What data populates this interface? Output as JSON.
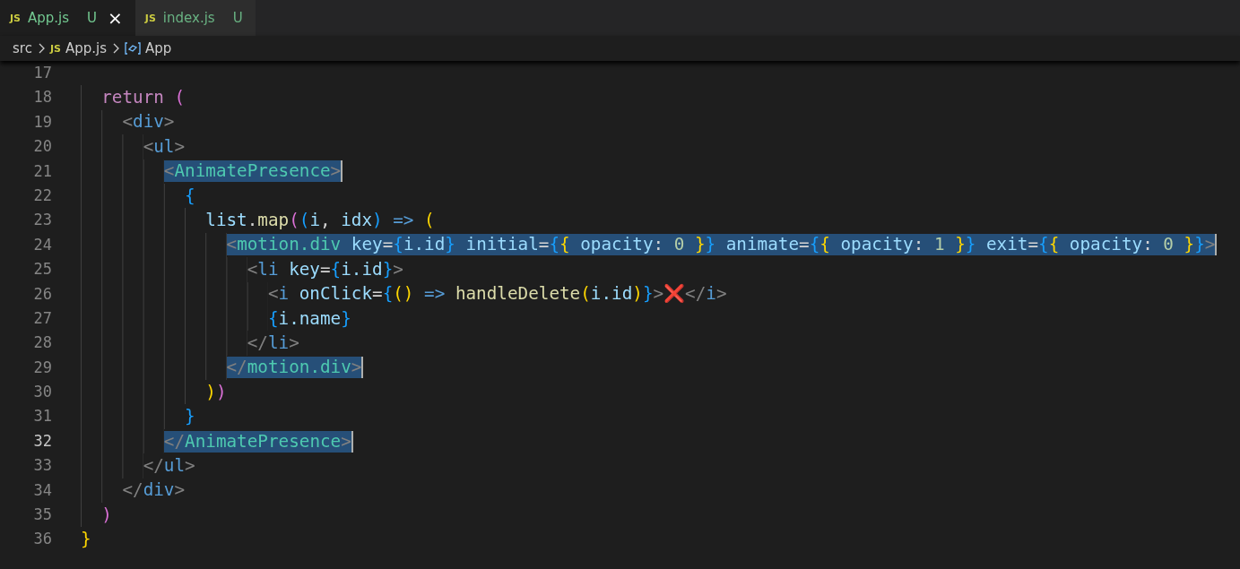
{
  "tabs": [
    {
      "icon_text": "JS",
      "label": "App.js",
      "status": "U",
      "selected": true,
      "close": "×"
    },
    {
      "icon_text": "JS",
      "label": "index.js",
      "status": "U",
      "selected": false
    }
  ],
  "breadcrumb": [
    {
      "kind": "folder",
      "label": "src"
    },
    {
      "kind": "file",
      "icon_text": "JS",
      "label": "App.js"
    },
    {
      "kind": "symbol",
      "label": "App"
    }
  ],
  "editor": {
    "lines": [
      {
        "number": "17",
        "current": false,
        "selected": false
      },
      {
        "number": "18",
        "current": false,
        "selected": false,
        "tokens": [
          {
            "kind": "keyword",
            "text": "  return"
          },
          {
            "kind": "bracket-pink",
            "text": " ("
          }
        ]
      },
      {
        "number": "19",
        "current": false,
        "selected": false,
        "tokens": [
          {
            "kind": "angle",
            "text": "    <"
          },
          {
            "kind": "tag",
            "text": "div"
          },
          {
            "kind": "angle",
            "text": ">"
          }
        ]
      },
      {
        "number": "20",
        "current": false,
        "selected": false,
        "tokens": [
          {
            "kind": "angle",
            "text": "      <"
          },
          {
            "kind": "tag",
            "text": "ul"
          },
          {
            "kind": "angle",
            "text": ">"
          }
        ]
      },
      {
        "number": "21",
        "current": false,
        "selected": true,
        "tokens": [
          {
            "kind": "angle",
            "text": "        <"
          },
          {
            "kind": "component",
            "text": "AnimatePresence"
          },
          {
            "kind": "angle",
            "text": ">"
          }
        ]
      },
      {
        "number": "22",
        "current": false,
        "selected": false,
        "tokens": [
          {
            "kind": "bracket-blue",
            "text": "          {"
          }
        ]
      },
      {
        "number": "23",
        "current": false,
        "selected": false,
        "tokens": [
          {
            "kind": "variable",
            "text": "            list"
          },
          {
            "kind": "plain",
            "text": "."
          },
          {
            "kind": "function",
            "text": "map"
          },
          {
            "kind": "bracket-pink",
            "text": "("
          },
          {
            "kind": "bracket-blue",
            "text": "("
          },
          {
            "kind": "variable",
            "text": "i"
          },
          {
            "kind": "plain",
            "text": ","
          },
          {
            "kind": "variable",
            "text": " idx"
          },
          {
            "kind": "bracket-blue",
            "text": ")"
          },
          {
            "kind": "operator",
            "text": " =>"
          },
          {
            "kind": "bracket-gold",
            "text": " ("
          }
        ]
      },
      {
        "number": "24",
        "current": false,
        "selected": true,
        "tokens": [
          {
            "kind": "angle",
            "text": "              <"
          },
          {
            "kind": "component",
            "text": "motion.div"
          },
          {
            "kind": "attribute",
            "text": " key"
          },
          {
            "kind": "plain",
            "text": "="
          },
          {
            "kind": "bracket-blue",
            "text": "{"
          },
          {
            "kind": "variable",
            "text": "i.id"
          },
          {
            "kind": "bracket-blue",
            "text": "}"
          },
          {
            "kind": "attribute",
            "text": " initial"
          },
          {
            "kind": "plain",
            "text": "="
          },
          {
            "kind": "bracket-blue",
            "text": "{"
          },
          {
            "kind": "bracket-gold",
            "text": "{"
          },
          {
            "kind": "variable",
            "text": " opacity"
          },
          {
            "kind": "plain",
            "text": ":"
          },
          {
            "kind": "number",
            "text": " 0"
          },
          {
            "kind": "bracket-gold",
            "text": " }"
          },
          {
            "kind": "bracket-blue",
            "text": "}"
          },
          {
            "kind": "attribute",
            "text": " animate"
          },
          {
            "kind": "plain",
            "text": "="
          },
          {
            "kind": "bracket-blue",
            "text": "{"
          },
          {
            "kind": "bracket-gold",
            "text": "{"
          },
          {
            "kind": "variable",
            "text": " opacity"
          },
          {
            "kind": "plain",
            "text": ":"
          },
          {
            "kind": "number",
            "text": " 1"
          },
          {
            "kind": "bracket-gold",
            "text": " }"
          },
          {
            "kind": "bracket-blue",
            "text": "}"
          },
          {
            "kind": "attribute",
            "text": " exit"
          },
          {
            "kind": "plain",
            "text": "="
          },
          {
            "kind": "bracket-blue",
            "text": "{"
          },
          {
            "kind": "bracket-gold",
            "text": "{"
          },
          {
            "kind": "variable",
            "text": " opacity"
          },
          {
            "kind": "plain",
            "text": ":"
          },
          {
            "kind": "number",
            "text": " 0"
          },
          {
            "kind": "bracket-gold",
            "text": " }"
          },
          {
            "kind": "bracket-blue",
            "text": "}"
          },
          {
            "kind": "angle",
            "text": ">"
          }
        ]
      },
      {
        "number": "25",
        "current": false,
        "selected": false,
        "tokens": [
          {
            "kind": "angle",
            "text": "                <"
          },
          {
            "kind": "tag",
            "text": "li"
          },
          {
            "kind": "attribute",
            "text": " key"
          },
          {
            "kind": "plain",
            "text": "="
          },
          {
            "kind": "bracket-blue",
            "text": "{"
          },
          {
            "kind": "variable",
            "text": "i.id"
          },
          {
            "kind": "bracket-blue",
            "text": "}"
          },
          {
            "kind": "angle",
            "text": ">"
          }
        ]
      },
      {
        "number": "26",
        "current": false,
        "selected": false,
        "tokens": [
          {
            "kind": "angle",
            "text": "                  <"
          },
          {
            "kind": "tag",
            "text": "i"
          },
          {
            "kind": "attribute",
            "text": " onClick"
          },
          {
            "kind": "plain",
            "text": "="
          },
          {
            "kind": "bracket-blue",
            "text": "{"
          },
          {
            "kind": "bracket-gold",
            "text": "()"
          },
          {
            "kind": "operator",
            "text": " =>"
          },
          {
            "kind": "function",
            "text": " handleDelete"
          },
          {
            "kind": "bracket-gold",
            "text": "("
          },
          {
            "kind": "variable",
            "text": "i.id"
          },
          {
            "kind": "bracket-gold",
            "text": ")"
          },
          {
            "kind": "bracket-blue",
            "text": "}"
          },
          {
            "kind": "angle",
            "text": ">"
          },
          {
            "kind": "emoji",
            "text": "❌"
          },
          {
            "kind": "angle",
            "text": "</"
          },
          {
            "kind": "tag",
            "text": "i"
          },
          {
            "kind": "angle",
            "text": ">"
          }
        ]
      },
      {
        "number": "27",
        "current": false,
        "selected": false,
        "tokens": [
          {
            "kind": "bracket-blue",
            "text": "                  {"
          },
          {
            "kind": "variable",
            "text": "i.name"
          },
          {
            "kind": "bracket-blue",
            "text": "}"
          }
        ]
      },
      {
        "number": "28",
        "current": false,
        "selected": false,
        "tokens": [
          {
            "kind": "angle",
            "text": "                </"
          },
          {
            "kind": "tag",
            "text": "li"
          },
          {
            "kind": "angle",
            "text": ">"
          }
        ]
      },
      {
        "number": "29",
        "current": false,
        "selected": true,
        "tokens": [
          {
            "kind": "angle",
            "text": "              </"
          },
          {
            "kind": "component",
            "text": "motion.div"
          },
          {
            "kind": "angle",
            "text": ">"
          }
        ]
      },
      {
        "number": "30",
        "current": false,
        "selected": false,
        "tokens": [
          {
            "kind": "bracket-gold",
            "text": "            )"
          },
          {
            "kind": "bracket-pink",
            "text": ")"
          }
        ]
      },
      {
        "number": "31",
        "current": false,
        "selected": false,
        "tokens": [
          {
            "kind": "bracket-blue",
            "text": "          }"
          }
        ]
      },
      {
        "number": "32",
        "current": true,
        "selected": true,
        "tokens": [
          {
            "kind": "angle",
            "text": "        </"
          },
          {
            "kind": "component",
            "text": "AnimatePresence"
          },
          {
            "kind": "angle",
            "text": ">"
          }
        ]
      },
      {
        "number": "33",
        "current": false,
        "selected": false,
        "tokens": [
          {
            "kind": "angle",
            "text": "      </"
          },
          {
            "kind": "tag",
            "text": "ul"
          },
          {
            "kind": "angle",
            "text": ">"
          }
        ]
      },
      {
        "number": "34",
        "current": false,
        "selected": false,
        "tokens": [
          {
            "kind": "angle",
            "text": "    </"
          },
          {
            "kind": "tag",
            "text": "div"
          },
          {
            "kind": "angle",
            "text": ">"
          }
        ]
      },
      {
        "number": "35",
        "current": false,
        "selected": false,
        "tokens": [
          {
            "kind": "bracket-pink",
            "text": "  )"
          }
        ]
      },
      {
        "number": "36",
        "current": false,
        "selected": false,
        "tokens": [
          {
            "kind": "bracket-gold",
            "text": "}"
          }
        ]
      }
    ]
  }
}
